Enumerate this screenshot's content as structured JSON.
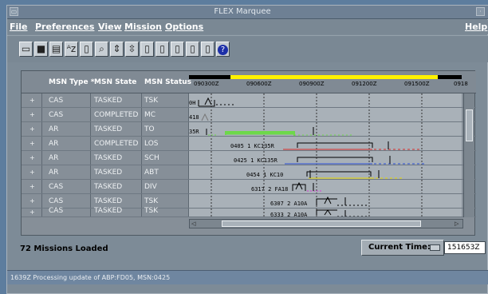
{
  "window": {
    "title": "FLEX Marquee"
  },
  "menu": {
    "file": "File",
    "preferences": "Preferences",
    "view": "View",
    "mission": "Mission",
    "options": "Options",
    "help": "Help"
  },
  "table": {
    "columns": [
      "MSN Type *",
      "MSN State",
      "MSN Status"
    ],
    "rows": [
      {
        "type": "CAS",
        "state": "TASKED",
        "status": "TSK",
        "label": "0H"
      },
      {
        "type": "CAS",
        "state": "COMPLETED",
        "status": "MC",
        "label": "418"
      },
      {
        "type": "AR",
        "state": "TASKED",
        "status": "TO",
        "label": "35R"
      },
      {
        "type": "AR",
        "state": "COMPLETED",
        "status": "LOS",
        "label": "0405 1 KC135R"
      },
      {
        "type": "AR",
        "state": "TASKED",
        "status": "SCH",
        "label": "0425 1 KC135R"
      },
      {
        "type": "AR",
        "state": "TASKED",
        "status": "ABT",
        "label": "0454 1 KC10"
      },
      {
        "type": "CAS",
        "state": "TASKED",
        "status": "DIV",
        "label": "6317 2 FA18"
      },
      {
        "type": "CAS",
        "state": "TASKED",
        "status": "TSK",
        "label": "6307 2 A10A"
      },
      {
        "type": "CAS",
        "state": "TASKED",
        "status": "TSK",
        "label": "6333 2 A10A"
      }
    ]
  },
  "timeline": {
    "ticks": [
      "090300Z",
      "090600Z",
      "090900Z",
      "091200Z",
      "091500Z",
      "0918"
    ]
  },
  "footer": {
    "missions_loaded": "72 Missions Loaded",
    "current_time_label": "Current Time:",
    "current_time_value": "151653Z"
  },
  "message_bar": {
    "text": "1639Z    Processing update of ABP:FD05, MSN:0425"
  },
  "colors": {
    "accent_yellow": "#fff200",
    "green": "#6dd84a",
    "red": "#d62a2a",
    "blue": "#2a4fd6",
    "yellow": "#e6d700",
    "magenta": "#d93ed9"
  }
}
